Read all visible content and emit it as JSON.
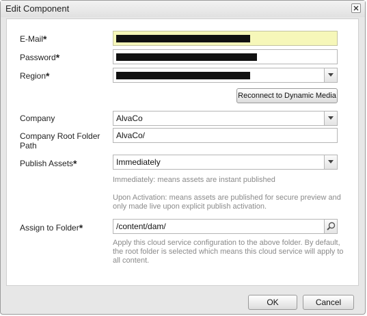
{
  "dialog": {
    "title": "Edit Component",
    "close_icon": "close-icon"
  },
  "form": {
    "email": {
      "label": "E-Mail",
      "required": "*",
      "value": ""
    },
    "password": {
      "label": "Password",
      "required": "*",
      "value": ""
    },
    "region": {
      "label": "Region",
      "required": "*",
      "value": ""
    },
    "reconnect_button": "Reconnect to Dynamic Media",
    "company": {
      "label": "Company",
      "value": "AlvaCo"
    },
    "company_root": {
      "label": "Company Root Folder Path",
      "value": "AlvaCo/"
    },
    "publish_assets": {
      "label": "Publish Assets",
      "required": "*",
      "value": "Immediately",
      "help_immediately": "Immediately: means assets are instant published",
      "help_upon_activation": "Upon Activation: means assets are published for secure preview and only made live upon explicit publish activation."
    },
    "assign_folder": {
      "label": "Assign to Folder",
      "required": "*",
      "value": "/content/dam/",
      "help": "Apply this cloud service configuration to the above folder. By default, the root folder is selected which means this cloud service will apply to all content."
    }
  },
  "footer": {
    "ok_label": "OK",
    "cancel_label": "Cancel"
  },
  "colors": {
    "email_highlight": "#f6f7b9",
    "dialog_background": "#e7e7e7",
    "help_text": "#8a8a8a"
  }
}
